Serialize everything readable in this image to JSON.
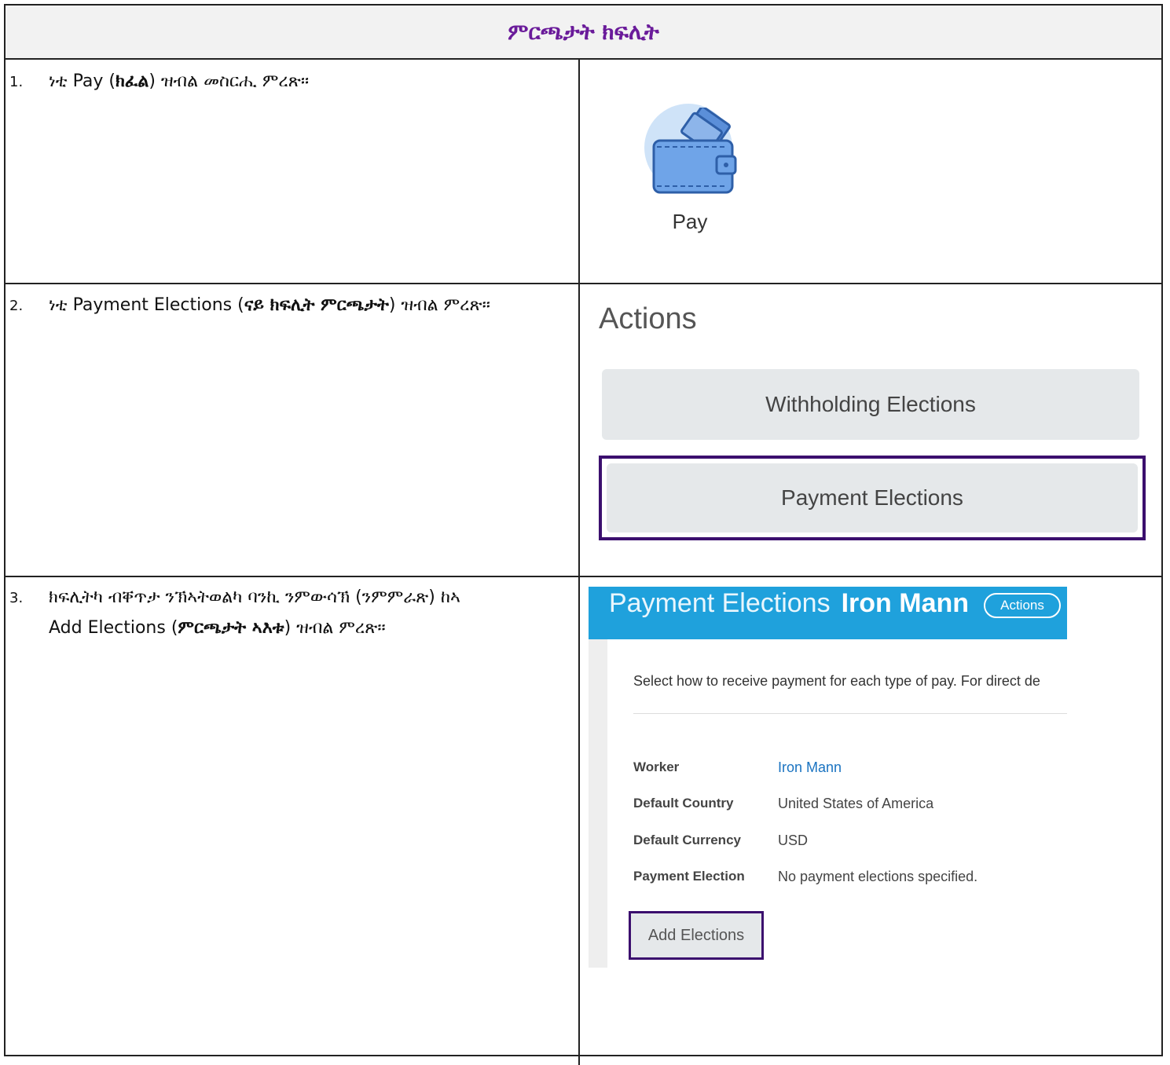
{
  "document": {
    "title": "ምርጫታት ክፍሊት"
  },
  "steps": [
    {
      "number": "1.",
      "prefix": "ነቲ Pay (",
      "bold": "ክፈል",
      "suffix": ") ዝብል መስርሒ ምረጽ።"
    },
    {
      "number": "2.",
      "prefix": "ነቲ Payment Elections (",
      "bold": "ናይ ክፍሊት ምርጫታት",
      "suffix": ") ዝብል ምረጽ።"
    },
    {
      "number": "3.",
      "line1": "ክፍሊትካ ብቐጥታ ንኽኣትወልካ ባንኪ ንምውሳኽ (ንምምራጽ) ከኣ",
      "prefix": "Add Elections (",
      "bold": "ምርጫታት ኣእቱ",
      "suffix": ") ዝብል ምረጽ።"
    }
  ],
  "pay_tile": {
    "label": "Pay",
    "icon": "wallet-icon"
  },
  "actions_panel": {
    "heading": "Actions",
    "buttons": [
      "Withholding Elections",
      "Payment Elections"
    ]
  },
  "workday_panel": {
    "title": "Payment Elections",
    "worker_name": "Iron Mann",
    "actions_button": "Actions",
    "description": "Select how to receive payment for each type of pay. For direct de",
    "fields": [
      {
        "label": "Worker",
        "value": "Iron Mann"
      },
      {
        "label": "Default Country",
        "value": "United States of America"
      },
      {
        "label": "Default Currency",
        "value": "USD"
      },
      {
        "label": "Payment Election",
        "value": "No payment elections specified."
      }
    ],
    "add_button": "Add Elections"
  },
  "colors": {
    "title_text": "#6a1b9a",
    "highlight_border": "#3b0f6e",
    "workday_blue": "#1fa1dc",
    "link_blue": "#1a73c1"
  }
}
